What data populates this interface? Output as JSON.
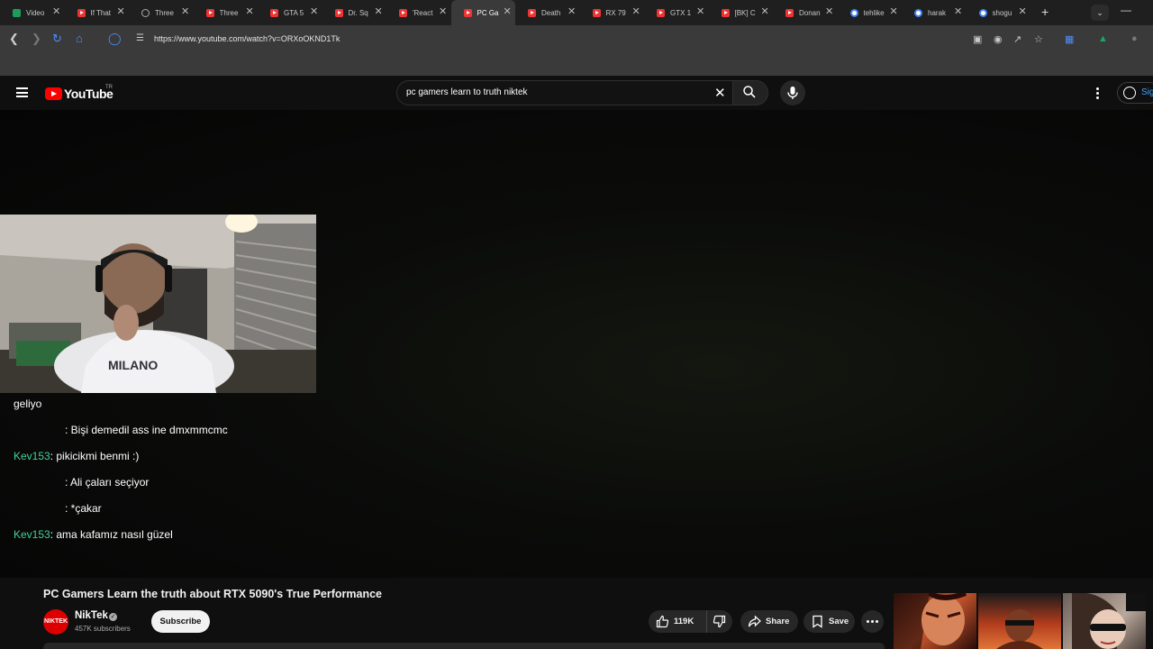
{
  "browser": {
    "tabs": [
      {
        "title": "Video",
        "icon": "upload-icon"
      },
      {
        "title": "If That",
        "icon": "youtube-icon"
      },
      {
        "title": "Three",
        "icon": "tiktok-icon"
      },
      {
        "title": "Three",
        "icon": "youtube-icon"
      },
      {
        "title": "GTA 5",
        "icon": "youtube-icon"
      },
      {
        "title": "Dr. Sq",
        "icon": "youtube-icon"
      },
      {
        "title": "'React",
        "icon": "youtube-icon"
      },
      {
        "title": "PC Ga",
        "icon": "youtube-icon",
        "active": true
      },
      {
        "title": "Death",
        "icon": "youtube-icon"
      },
      {
        "title": "RX 79",
        "icon": "youtube-icon"
      },
      {
        "title": "GTX 1",
        "icon": "youtube-icon"
      },
      {
        "title": "[BK] C",
        "icon": "youtube-icon"
      },
      {
        "title": "Donan",
        "icon": "youtube-icon"
      },
      {
        "title": "tehlike",
        "icon": "google-icon"
      },
      {
        "title": "harak",
        "icon": "google-icon"
      },
      {
        "title": "shogu",
        "icon": "google-icon"
      }
    ],
    "url": "https://www.youtube.com/watch?v=ORXoOKND1Tk"
  },
  "youtube": {
    "logo_text": "YouTube",
    "region": "TR",
    "search_query": "pc gamers learn to truth niktek",
    "signin_label": "Sig"
  },
  "chat": [
    {
      "user": "",
      "text": "geliyo",
      "indent": false
    },
    {
      "user": "",
      "text": ": Bişi demedil ass ine dmxmmcmc",
      "indent": true
    },
    {
      "user": "Kev153",
      "text": ": pikicikmi benmi :)",
      "indent": false
    },
    {
      "user": "",
      "text": ": Ali çaları seçiyor",
      "indent": true
    },
    {
      "user": "",
      "text": ": *çakar",
      "indent": true
    },
    {
      "user": "Kev153",
      "text": ": ama kafamız nasıl güzel",
      "indent": false
    }
  ],
  "video": {
    "title": "PC Gamers Learn the truth about RTX 5090's True Performance",
    "channel": "NikTek",
    "channel_avatar_text": "NIKTEK",
    "subscribers": "457K subscribers",
    "subscribe_label": "Subscribe",
    "likes": "119K",
    "share_label": "Share",
    "save_label": "Save"
  }
}
